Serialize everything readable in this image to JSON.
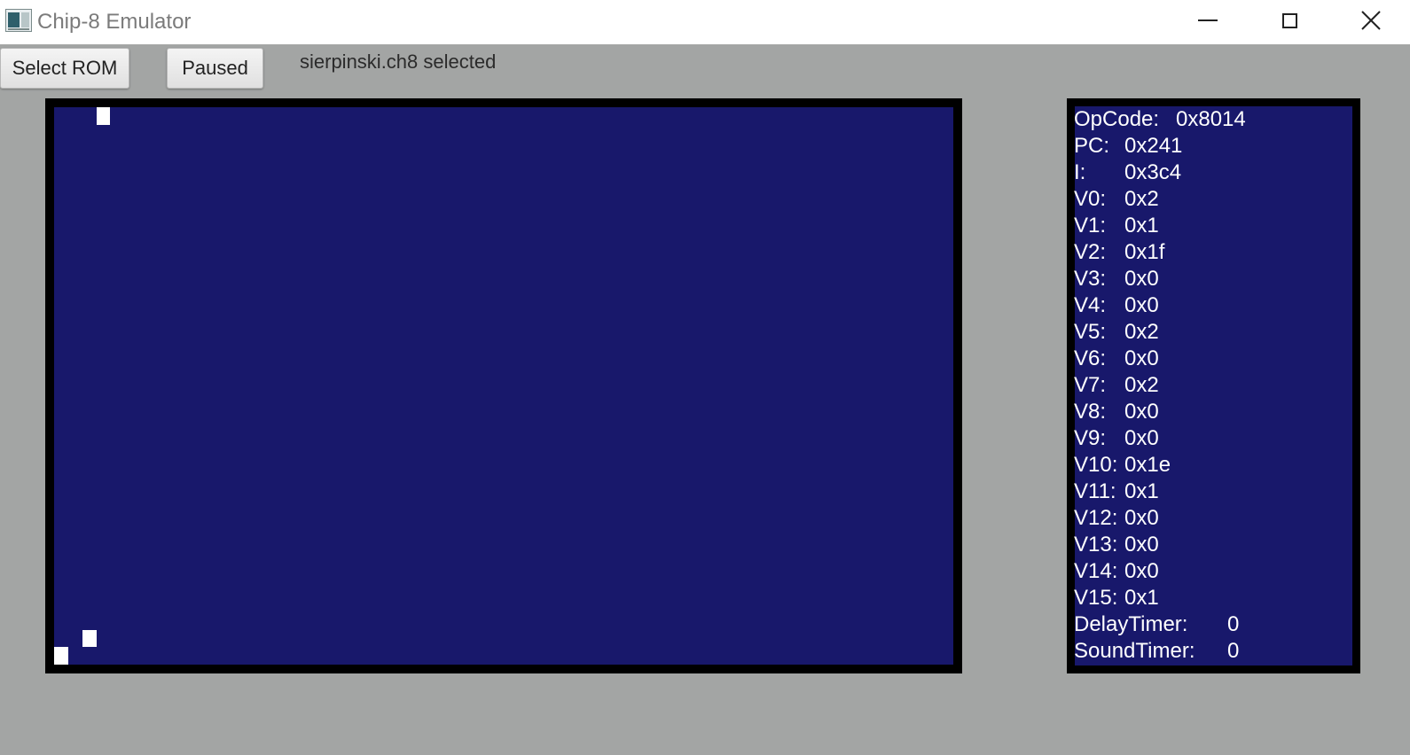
{
  "window": {
    "title": "Chip-8 Emulator",
    "icon": "app-icon",
    "controls": [
      "minimize-icon",
      "maximize-icon",
      "close-icon"
    ]
  },
  "toolbar": {
    "select_rom_label": "Select ROM",
    "pause_label": "Paused",
    "status": "sierpinski.ch8 selected"
  },
  "display": {
    "resolution": [
      64,
      32
    ],
    "lit_pixels": [
      [
        3,
        0
      ],
      [
        2,
        30
      ],
      [
        0,
        31
      ]
    ]
  },
  "colors": {
    "screen_bg": "#18186b",
    "pixel_on": "#ffffff",
    "frame": "#000000",
    "window_bg": "#a3a5a4"
  },
  "registers": [
    {
      "name": "OpCode:",
      "value": "0x8014"
    },
    {
      "name": "PC:",
      "value": "0x241"
    },
    {
      "name": "I:",
      "value": "0x3c4"
    },
    {
      "name": "V0:",
      "value": "0x2"
    },
    {
      "name": "V1:",
      "value": "0x1"
    },
    {
      "name": "V2:",
      "value": "0x1f"
    },
    {
      "name": "V3:",
      "value": "0x0"
    },
    {
      "name": "V4:",
      "value": "0x0"
    },
    {
      "name": "V5:",
      "value": "0x2"
    },
    {
      "name": "V6:",
      "value": "0x0"
    },
    {
      "name": "V7:",
      "value": "0x2"
    },
    {
      "name": "V8:",
      "value": "0x0"
    },
    {
      "name": "V9:",
      "value": "0x0"
    },
    {
      "name": "V10:",
      "value": "0x1e"
    },
    {
      "name": "V11:",
      "value": "0x1"
    },
    {
      "name": "V12:",
      "value": "0x0"
    },
    {
      "name": "V13:",
      "value": "0x0"
    },
    {
      "name": "V14:",
      "value": "0x0"
    },
    {
      "name": "V15:",
      "value": "0x1"
    },
    {
      "name": "DelayTimer:",
      "value": "0"
    },
    {
      "name": "SoundTimer:",
      "value": "0"
    }
  ]
}
